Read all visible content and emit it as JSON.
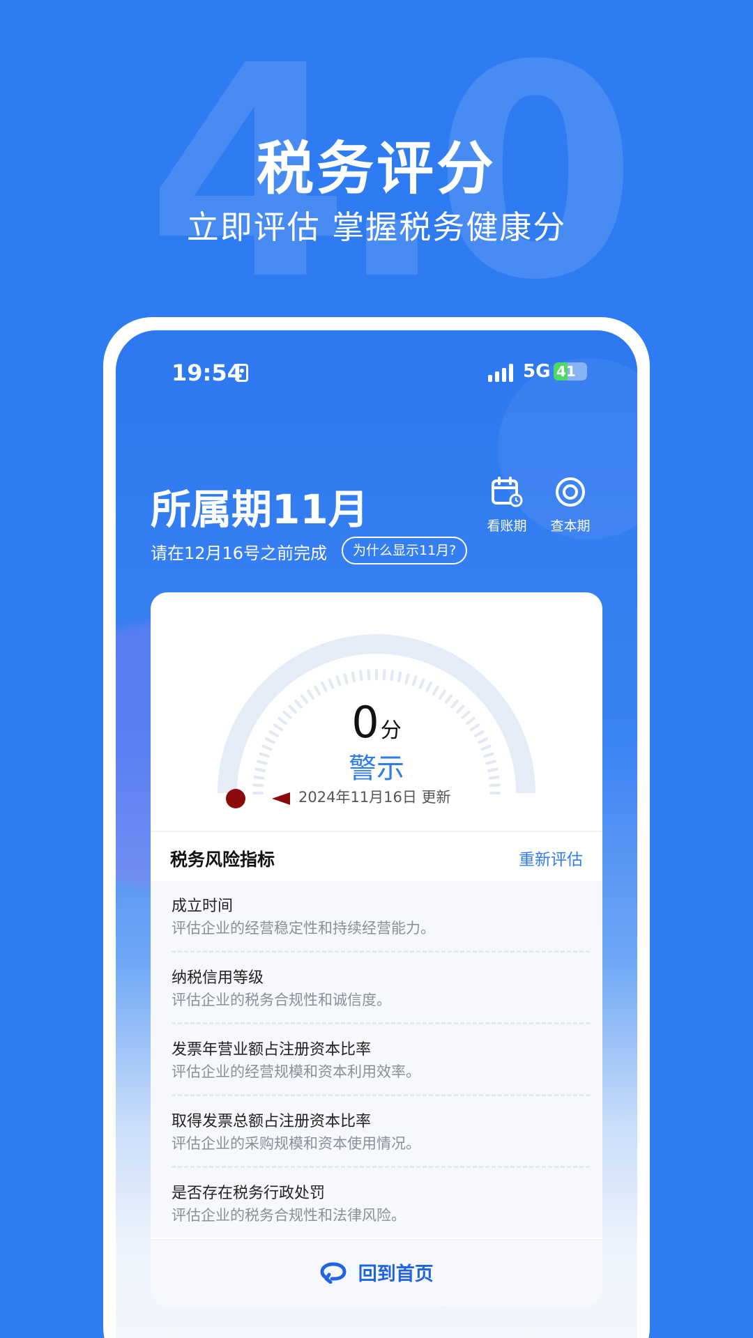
{
  "promo": {
    "watermark": "4.0",
    "title": "税务评分",
    "subtitle": "立即评估 掌握税务健康分"
  },
  "status_bar": {
    "time": "19:54",
    "network": "5G",
    "battery": "41",
    "battery_level": 0.41
  },
  "header": {
    "period_title": "所属期11月",
    "deadline_text": "请在12月16号之前完成",
    "why_badge": "为什么显示11月?",
    "actions": [
      {
        "label": "看账期",
        "icon": "calendar-clock-icon"
      },
      {
        "label": "查本期",
        "icon": "target-ring-icon"
      }
    ]
  },
  "score_card": {
    "score": "0",
    "score_value": 0,
    "score_max": 100,
    "unit": "分",
    "level": "警示",
    "updated": "2024年11月16日 更新"
  },
  "risk_section": {
    "title": "税务风险指标",
    "reevaluate": "重新评估",
    "items": [
      {
        "name": "成立时间",
        "desc": "评估企业的经营稳定性和持续经营能力。"
      },
      {
        "name": "纳税信用等级",
        "desc": "评估企业的税务合规性和诚信度。"
      },
      {
        "name": "发票年营业额占注册资本比率",
        "desc": "评估企业的经营规模和资本利用效率。"
      },
      {
        "name": "取得发票总额占注册资本比率",
        "desc": "评估企业的采购规模和资本使用情况。"
      },
      {
        "name": "是否存在税务行政处罚",
        "desc": "评估企业的税务合规性和法律风险。"
      }
    ]
  },
  "footer": {
    "home_label": "回到首页"
  },
  "colors": {
    "background": "#2F7BF2",
    "accent": "#2F7BF2",
    "gauge_track": "#E6ECF7",
    "needle": "#8B0A0A"
  }
}
